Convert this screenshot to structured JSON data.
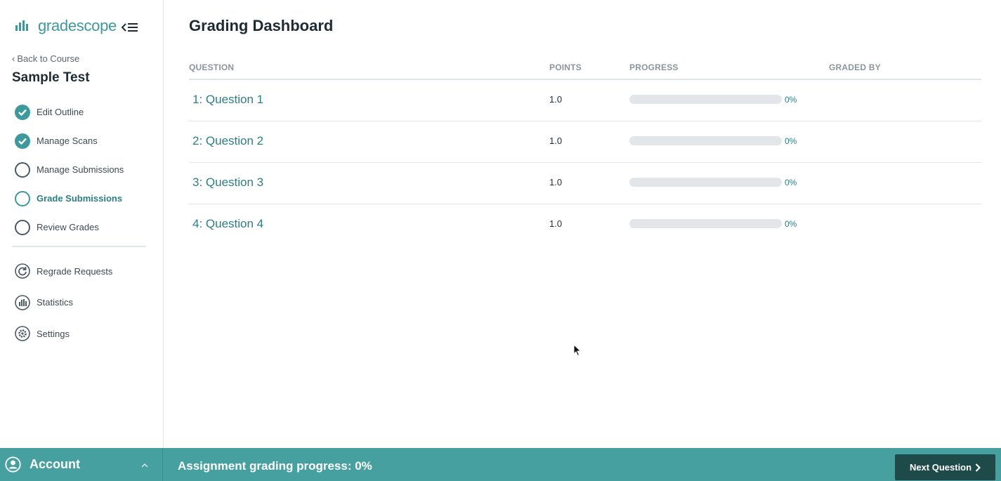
{
  "brand": {
    "name": "gradescope",
    "accent": "#3d9a9c"
  },
  "sidebar": {
    "back_label": "Back to Course",
    "assignment_title": "Sample Test",
    "steps": [
      {
        "label": "Edit Outline",
        "state": "done"
      },
      {
        "label": "Manage Scans",
        "state": "done"
      },
      {
        "label": "Manage Submissions",
        "state": "todo"
      },
      {
        "label": "Grade Submissions",
        "state": "current"
      },
      {
        "label": "Review Grades",
        "state": "todo"
      }
    ],
    "tools": [
      {
        "label": "Regrade Requests",
        "icon": "refresh-icon"
      },
      {
        "label": "Statistics",
        "icon": "bar-chart-icon"
      },
      {
        "label": "Settings",
        "icon": "gear-icon"
      }
    ]
  },
  "main": {
    "title": "Grading Dashboard",
    "columns": {
      "question": "QUESTION",
      "points": "POINTS",
      "progress": "PROGRESS",
      "graded_by": "GRADED BY"
    },
    "rows": [
      {
        "question": "1: Question 1",
        "points": "1.0",
        "progress": 0,
        "progress_label": "0%",
        "graded_by": ""
      },
      {
        "question": "2: Question 2",
        "points": "1.0",
        "progress": 0,
        "progress_label": "0%",
        "graded_by": ""
      },
      {
        "question": "3: Question 3",
        "points": "1.0",
        "progress": 0,
        "progress_label": "0%",
        "graded_by": ""
      },
      {
        "question": "4: Question 4",
        "points": "1.0",
        "progress": 0,
        "progress_label": "0%",
        "graded_by": ""
      }
    ]
  },
  "footer": {
    "account_label": "Account",
    "progress_text": "Assignment grading progress: 0%",
    "next_label": "Next Question"
  },
  "colors": {
    "footer_bg": "#46a0a0",
    "next_button_bg": "#1f4a4a",
    "link": "#2a7f86"
  }
}
